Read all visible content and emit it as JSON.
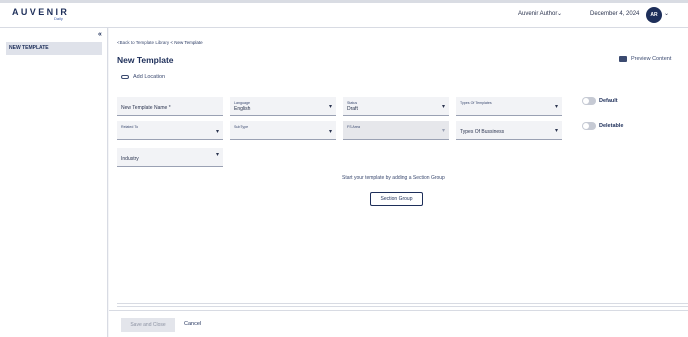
{
  "header": {
    "brand": "AUVENIR",
    "brand_sub": "Daily",
    "role": "Auvenir Author",
    "date": "December 4, 2024",
    "avatar_initials": "AR"
  },
  "sidebar": {
    "collapse_icon": "double-chevron-left-icon",
    "items": [
      {
        "label": "NEW TEMPLATE"
      }
    ]
  },
  "breadcrumb": {
    "back": "<Back to Template Library",
    "current": " < New Template"
  },
  "page": {
    "title": "New Template",
    "preview": "Preview Content",
    "add_location": "Add Location"
  },
  "form": {
    "template_name_placeholder": "New Template Name *",
    "language": {
      "label": "Language",
      "value": "English"
    },
    "status": {
      "label": "Status",
      "value": "Draft"
    },
    "types_of_templates": {
      "label": "Types Of Templates"
    },
    "related_to": {
      "label": "Related To"
    },
    "subtype": {
      "label": "SubType"
    },
    "fs_area": {
      "label": "FS Area"
    },
    "types_of_business": {
      "placeholder": "Types Of Bussiness"
    },
    "industry": {
      "placeholder": "Industry"
    },
    "default_toggle": "Default",
    "deletable_toggle": "Deletable"
  },
  "content": {
    "hint": "Start your template by adding a Section Group",
    "section_group_button": "Section Group"
  },
  "footer": {
    "save_close": "Save and Close",
    "cancel": "Cancel"
  },
  "colors": {
    "brand_navy": "#1e2f5a",
    "field_bg": "#f2f3f6",
    "sidebar_selected": "#dfe2ea"
  }
}
